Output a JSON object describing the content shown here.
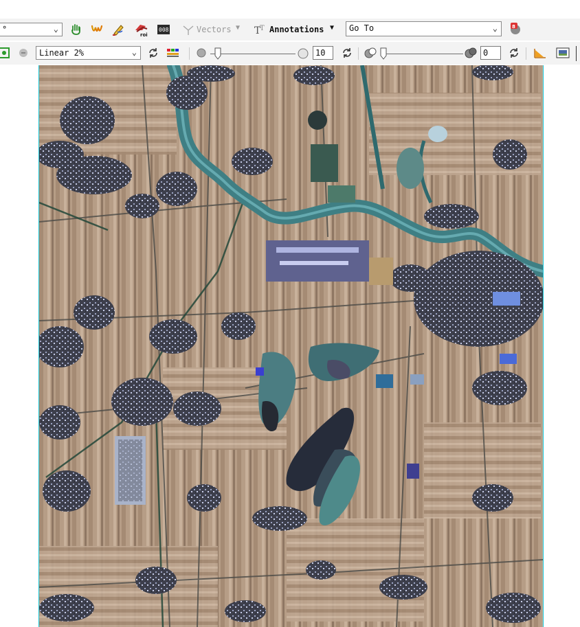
{
  "toolbar_top": {
    "rotation_combo": {
      "value": "°"
    },
    "vectors": {
      "label": "Vectors"
    },
    "annotations": {
      "label": "Annotations"
    },
    "goto": {
      "value": "Go To"
    }
  },
  "toolbar_bottom": {
    "stretch": {
      "value": "Linear 2%"
    },
    "sharpen": {
      "value": "10"
    },
    "transparency": {
      "value": "0"
    }
  },
  "colors": {
    "toolbar_bg": "#f3f3f3",
    "viewport_border": "#16c7d8",
    "water": "#3f7f84"
  },
  "icons": [
    "hand-pan-icon",
    "fly-icon",
    "pencil-icon",
    "roi-icon",
    "pixel-locator-icon",
    "vectors-icon",
    "annotations-icon",
    "goto-locate-icon",
    "display-refresh-icon",
    "chain-link-icon",
    "reset-icon",
    "color-table-icon",
    "sharpen-icon",
    "transparency-icon",
    "profile-icon",
    "portal-icon"
  ],
  "image": {
    "description_kind": "satellite-false-color-farmland"
  }
}
